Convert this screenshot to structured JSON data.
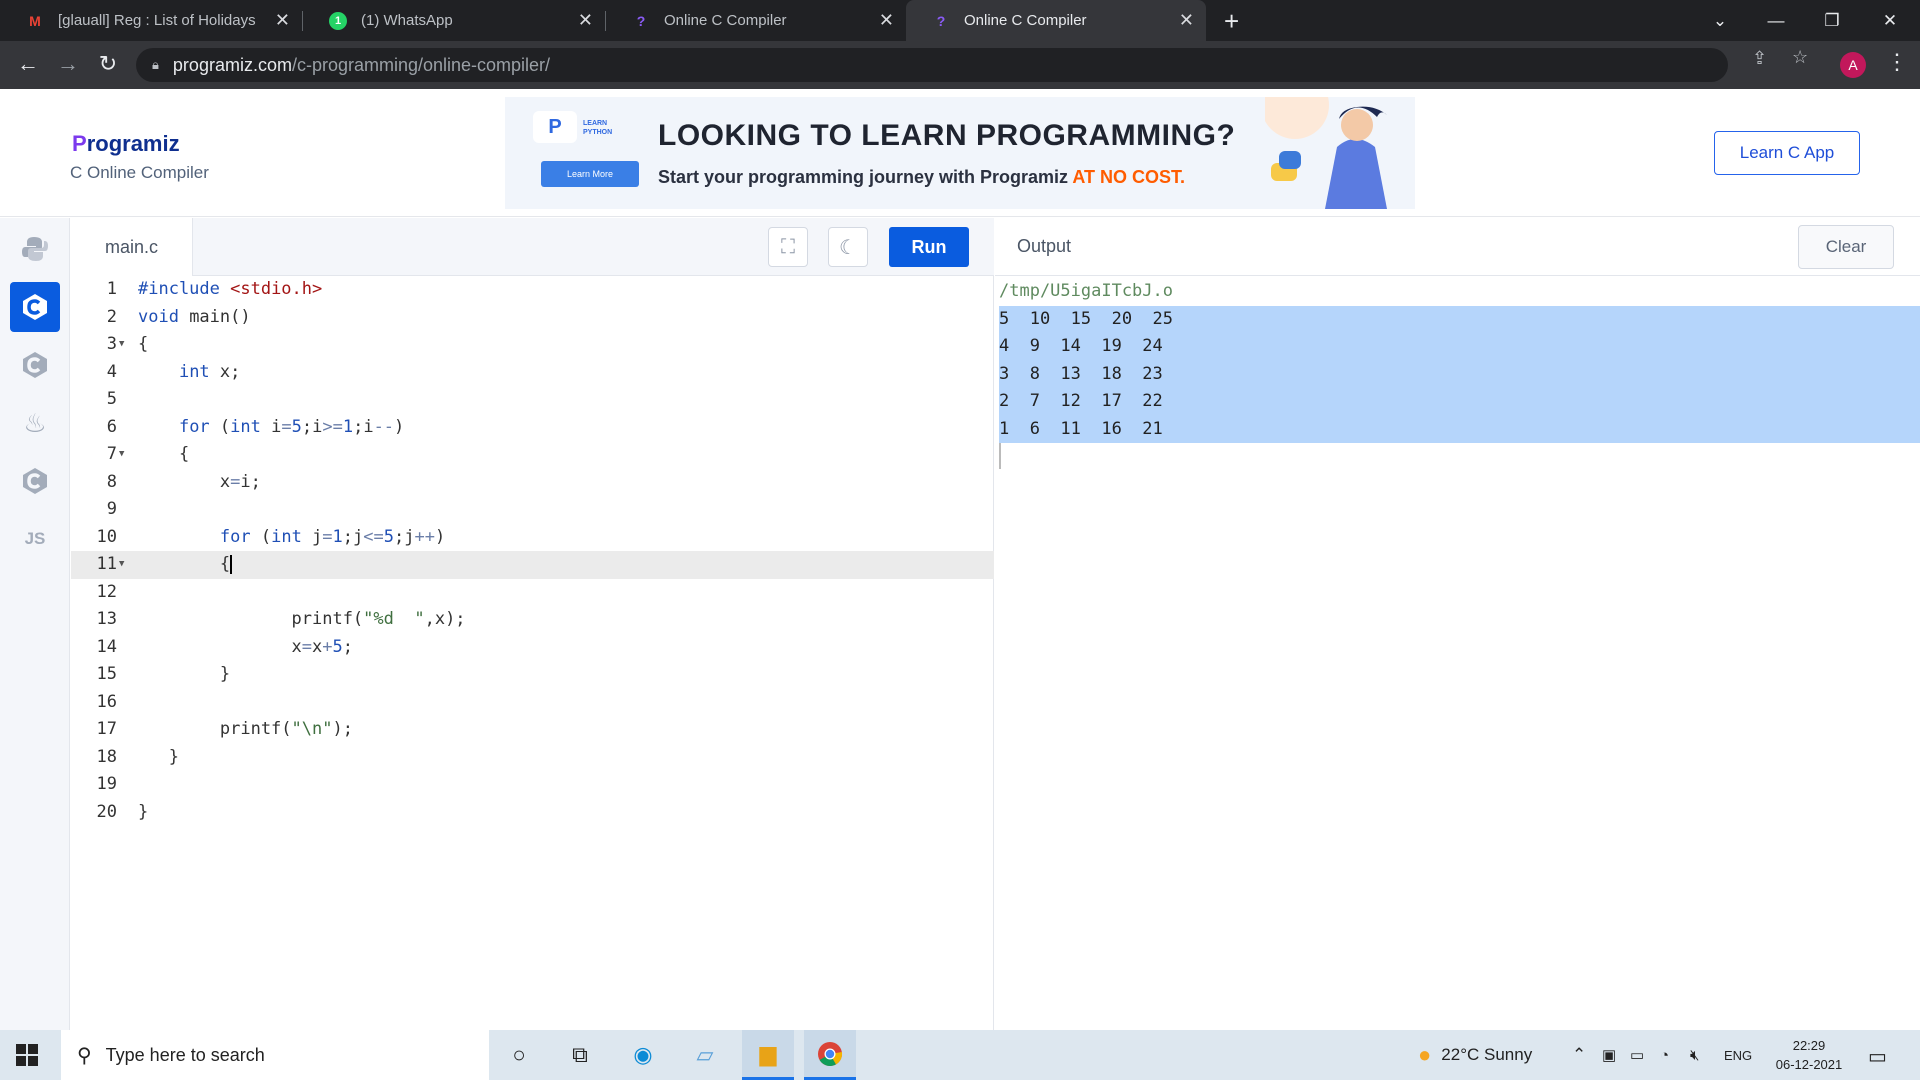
{
  "browser": {
    "tabs": [
      {
        "title": "[glauall] Reg : List of Holidays in I",
        "icon": "gmail-icon"
      },
      {
        "title": "(1) WhatsApp",
        "icon": "whatsapp-icon"
      },
      {
        "title": "Online C Compiler",
        "icon": "programiz-icon"
      },
      {
        "title": "Online C Compiler",
        "icon": "programiz-icon",
        "active": true
      }
    ],
    "url_host": "programiz.com",
    "url_path": "/c-programming/online-compiler/",
    "profile_initial": "A"
  },
  "header": {
    "logo_p": "P",
    "logo_rest": "rogramiz",
    "subtitle": "C Online Compiler",
    "learn_button": "Learn C App",
    "ad": {
      "badge_line1": "LEARN",
      "badge_line2": "PYTHON",
      "badge_button": "Learn More",
      "headline": "LOOKING TO LEARN PROGRAMMING?",
      "tagline": "Start your programming journey with Programiz ",
      "tagline_accent": "AT NO COST."
    }
  },
  "sidebar": {
    "languages": [
      {
        "name": "python",
        "icon": "python-icon"
      },
      {
        "name": "c",
        "icon": "c-icon",
        "active": true
      },
      {
        "name": "cpp",
        "icon": "cpp-icon"
      },
      {
        "name": "java",
        "icon": "java-icon"
      },
      {
        "name": "csharp",
        "icon": "csharp-icon"
      },
      {
        "name": "js",
        "label": "JS"
      }
    ]
  },
  "editor": {
    "filename": "main.c",
    "run_label": "Run",
    "current_line": 11,
    "lines": [
      "#include <stdio.h>",
      "void main()",
      "{",
      "    int x;",
      "",
      "    for (int i=5;i>=1;i--)",
      "    {",
      "        x=i;",
      "",
      "        for (int j=1;j<=5;j++)",
      "        {",
      "",
      "               printf(\"%d  \",x);",
      "               x=x+5;",
      "        }",
      "",
      "        printf(\"\\n\");",
      "   }",
      "",
      "}"
    ]
  },
  "output": {
    "title": "Output",
    "clear_label": "Clear",
    "path": "/tmp/U5igaITcbJ.o",
    "lines": [
      "5  10  15  20  25",
      "4  9  14  19  24",
      "3  8  13  18  23",
      "2  7  12  17  22",
      "1  6  11  16  21"
    ]
  },
  "taskbar": {
    "search_placeholder": "Type here to search",
    "weather": "22°C  Sunny",
    "language": "ENG",
    "time": "22:29",
    "date": "06-12-2021"
  }
}
